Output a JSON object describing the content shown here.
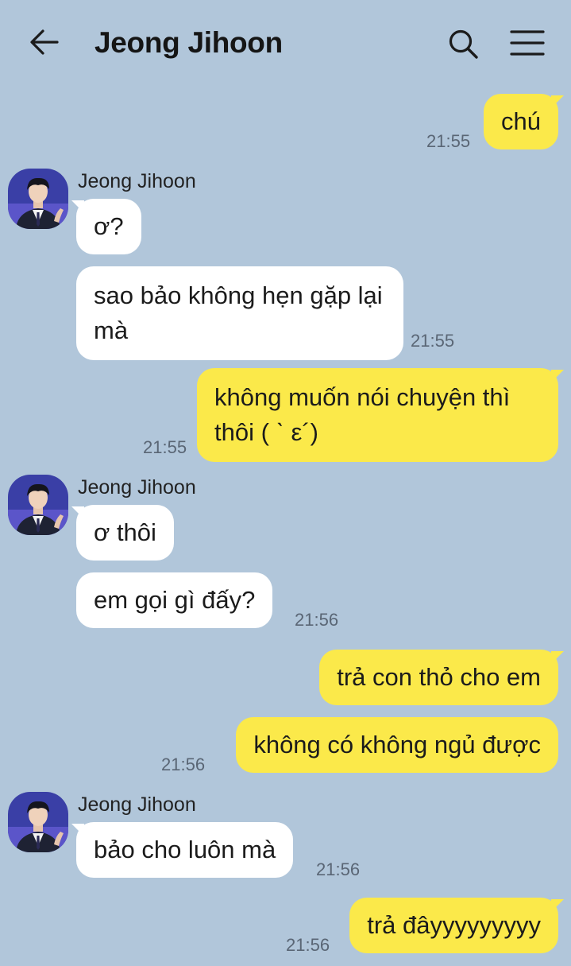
{
  "header": {
    "title": "Jeong Jihoon",
    "back_icon": "arrow-left-icon",
    "search_icon": "search-icon",
    "menu_icon": "hamburger-menu-icon"
  },
  "colors": {
    "background": "#b1c6da",
    "outgoing_bubble": "#fbe94a",
    "incoming_bubble": "#ffffff",
    "timestamp": "#5a6675"
  },
  "messages": [
    {
      "dir": "out",
      "text": "chú",
      "time": "21:55"
    },
    {
      "dir": "in",
      "sender": "Jeong Jihoon",
      "text": "ơ?"
    },
    {
      "dir": "in",
      "text": "sao bảo không hẹn gặp lại mà",
      "time": "21:55"
    },
    {
      "dir": "out",
      "text": "không muốn nói chuyện thì thôi ( ˋ ε´)",
      "time": "21:55"
    },
    {
      "dir": "in",
      "sender": "Jeong Jihoon",
      "text": "ơ thôi"
    },
    {
      "dir": "in",
      "text": "em gọi gì đấy?",
      "time": "21:56"
    },
    {
      "dir": "out",
      "text": "trả con thỏ cho em"
    },
    {
      "dir": "out",
      "text": "không có không ngủ được",
      "time": "21:56"
    },
    {
      "dir": "in",
      "sender": "Jeong Jihoon",
      "text": "bảo cho luôn mà",
      "time": "21:56"
    },
    {
      "dir": "out",
      "text": "trả đâyyyyyyyyy",
      "time": "21:56"
    }
  ]
}
